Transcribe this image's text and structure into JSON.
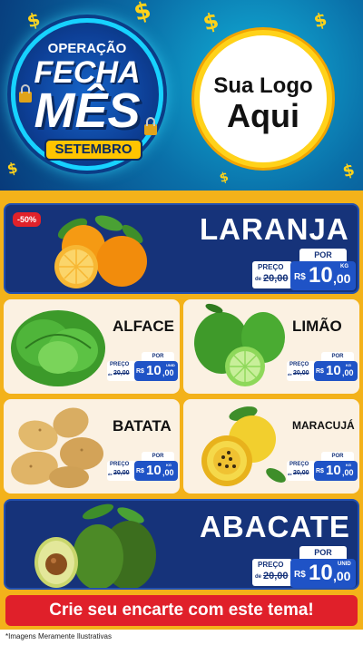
{
  "header": {
    "badge": {
      "line1": "OPERAÇÃO",
      "line2": "FECHA",
      "line3": "MÊS",
      "month": "SETEMBRO"
    },
    "logo": {
      "line1": "Sua Logo",
      "line2": "Aqui"
    },
    "dollar_symbol": "$"
  },
  "products": {
    "laranja": {
      "name": "LARANJA",
      "discount": "-50%",
      "old_label": "PREÇO",
      "old_prefix": "de",
      "old_price": "20,00",
      "por": "POR",
      "currency": "R$",
      "price": "10",
      "cents": ",00",
      "unit": "KG"
    },
    "alface": {
      "name": "ALFACE",
      "old_label": "PREÇO",
      "old_prefix": "de",
      "old_price": "20,00",
      "por": "POR",
      "currency": "R$",
      "price": "10",
      "cents": ",00",
      "unit": "UNID"
    },
    "limao": {
      "name": "LIMÃO",
      "old_label": "PREÇO",
      "old_prefix": "de",
      "old_price": "20,00",
      "por": "POR",
      "currency": "R$",
      "price": "10",
      "cents": ",00",
      "unit": "KG"
    },
    "batata": {
      "name": "BATATA",
      "old_label": "PREÇO",
      "old_prefix": "de",
      "old_price": "20,00",
      "por": "POR",
      "currency": "R$",
      "price": "10",
      "cents": ",00",
      "unit": "KG"
    },
    "maracuja": {
      "name": "MARACUJÁ",
      "old_label": "PREÇO",
      "old_prefix": "de",
      "old_price": "20,00",
      "por": "POR",
      "currency": "R$",
      "price": "10",
      "cents": ",00",
      "unit": "KG"
    },
    "abacate": {
      "name": "ABACATE",
      "old_label": "PREÇO",
      "old_prefix": "de",
      "old_price": "20,00",
      "por": "POR",
      "currency": "R$",
      "price": "10",
      "cents": ",00",
      "unit": "UNID"
    }
  },
  "cta": {
    "label": "Crie seu encarte com este tema!"
  },
  "footer": {
    "text": "*Imagens Meramente Ilustrativas"
  },
  "colors": {
    "navy": "#16337a",
    "blue": "#1f53c6",
    "red": "#e0202a",
    "gold": "#ffd21a",
    "background": "#f3b21a"
  }
}
